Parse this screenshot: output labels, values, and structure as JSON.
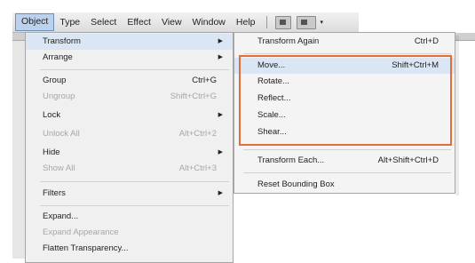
{
  "menubar": {
    "items": [
      {
        "label": "Object",
        "active": true
      },
      {
        "label": "Type"
      },
      {
        "label": "Select"
      },
      {
        "label": "Effect"
      },
      {
        "label": "View"
      },
      {
        "label": "Window"
      },
      {
        "label": "Help"
      }
    ],
    "toolbar_icons": [
      "arrange-documents-icon",
      "workspace-layout-icon"
    ],
    "caret": "▾"
  },
  "object_menu": {
    "items": [
      {
        "label": "Transform",
        "submenu": true
      },
      {
        "label": "Arrange",
        "submenu": true
      },
      {
        "label": "Group",
        "shortcut": "Ctrl+G"
      },
      {
        "label": "Ungroup",
        "shortcut": "Shift+Ctrl+G",
        "disabled": true
      },
      {
        "label": "Lock",
        "submenu": true
      },
      {
        "label": "Unlock All",
        "shortcut": "Alt+Ctrl+2",
        "disabled": true
      },
      {
        "label": "Hide",
        "submenu": true
      },
      {
        "label": "Show All",
        "shortcut": "Alt+Ctrl+3",
        "disabled": true
      },
      {
        "label": "Filters",
        "submenu": true
      },
      {
        "label": "Expand..."
      },
      {
        "label": "Expand Appearance",
        "disabled": true
      },
      {
        "label": "Flatten Transparency..."
      }
    ],
    "arrow": "▶"
  },
  "transform_submenu": {
    "items": [
      {
        "label": "Transform Again",
        "shortcut": "Ctrl+D"
      },
      {
        "label": "Move...",
        "shortcut": "Shift+Ctrl+M",
        "highlighted": true
      },
      {
        "label": "Rotate..."
      },
      {
        "label": "Reflect..."
      },
      {
        "label": "Scale..."
      },
      {
        "label": "Shear..."
      },
      {
        "label": "Transform Each...",
        "shortcut": "Alt+Shift+Ctrl+D"
      },
      {
        "label": "Reset Bounding Box"
      }
    ]
  },
  "colors": {
    "focus_outline": "#e06d3a",
    "active_menu_bg": "#bcd2ec",
    "hover_bg": "#dbe6f4",
    "disabled_text": "#a7a7a7"
  }
}
